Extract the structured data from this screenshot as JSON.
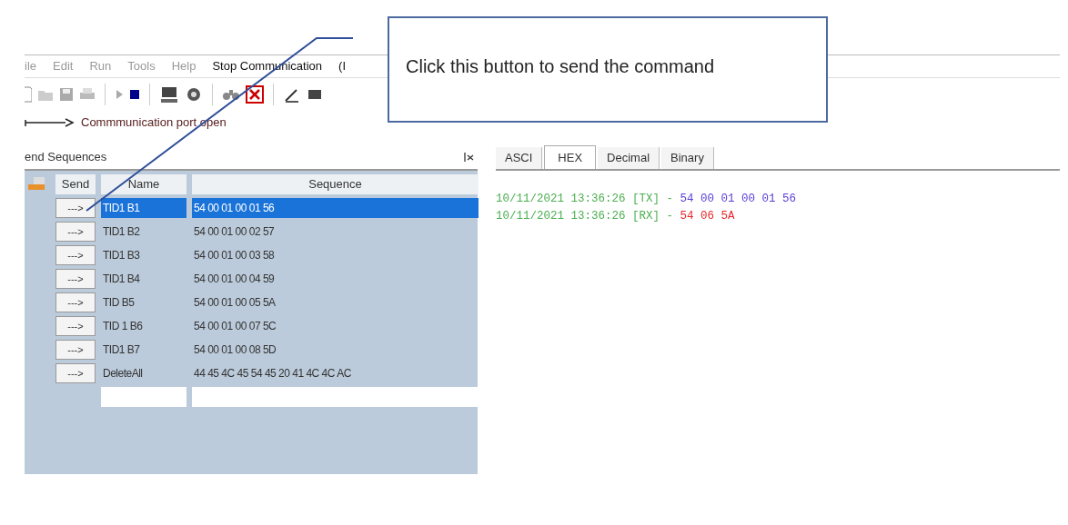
{
  "menu": [
    {
      "label": "ile",
      "disabled": true
    },
    {
      "label": "Edit",
      "disabled": true
    },
    {
      "label": "Run",
      "disabled": true
    },
    {
      "label": "Tools",
      "disabled": true
    },
    {
      "label": "Help",
      "disabled": true
    },
    {
      "label": "Stop Communication",
      "disabled": false
    },
    {
      "label": "(I",
      "disabled": false
    }
  ],
  "status": "Commmunication port open",
  "send_panel": {
    "title": "end Sequences",
    "columns": [
      "Send",
      "Name",
      "Sequence"
    ],
    "rows": [
      {
        "button": "--->",
        "name": "TID1 B1",
        "sequence": "54 00 01 00 01 56",
        "selected": true
      },
      {
        "button": "--->",
        "name": "TID1 B2",
        "sequence": "54 00 01 00 02 57",
        "selected": false
      },
      {
        "button": "--->",
        "name": "TID1 B3",
        "sequence": "54 00 01 00 03 58",
        "selected": false
      },
      {
        "button": "--->",
        "name": "TID1 B4",
        "sequence": "54 00 01 00 04 59",
        "selected": false
      },
      {
        "button": "--->",
        "name": "TID B5",
        "sequence": "54 00 01 00 05 5A",
        "selected": false
      },
      {
        "button": "--->",
        "name": "TID 1 B6",
        "sequence": "54 00 01 00 07 5C",
        "selected": false
      },
      {
        "button": "--->",
        "name": "TID1 B7",
        "sequence": "54 00 01 00 08 5D",
        "selected": false
      },
      {
        "button": "--->",
        "name": "DeleteAll",
        "sequence": "44 45 4C 45 54 45 20 41 4C 4C AC",
        "selected": false
      }
    ]
  },
  "view_tabs": [
    {
      "label": "ASCI",
      "selected": false
    },
    {
      "label": "HEX",
      "selected": true
    },
    {
      "label": "Decimal",
      "selected": false
    },
    {
      "label": "Binary",
      "selected": false
    }
  ],
  "log": [
    {
      "prefix": "10/11/2021 13:36:26 [TX] - ",
      "data": "54 00 01 00 01 56",
      "color": "#5b3fd6"
    },
    {
      "prefix": "10/11/2021 13:36:26 [RX] - ",
      "data": "54 06 5A",
      "color": "#e8262a"
    }
  ],
  "callout": {
    "text": "Click this button to send the command"
  }
}
